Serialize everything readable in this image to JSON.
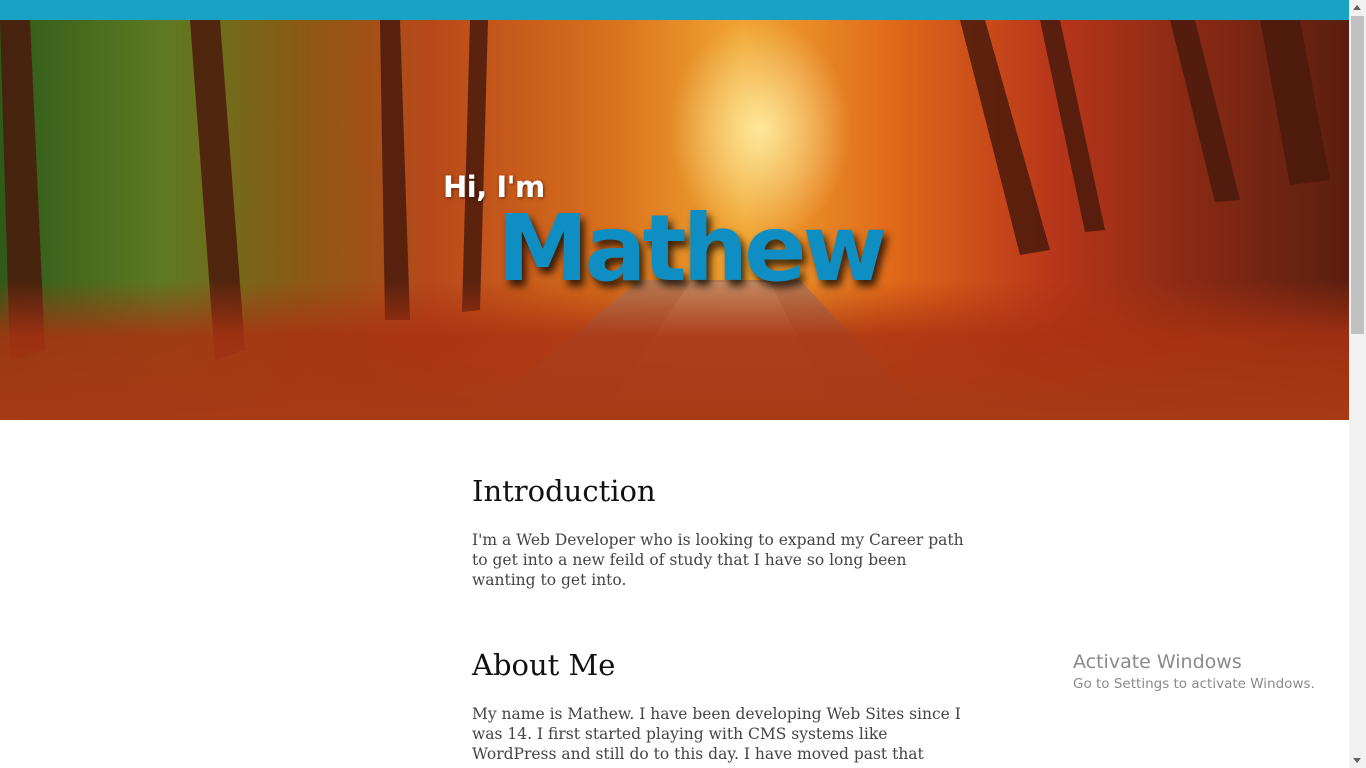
{
  "hero": {
    "greeting": "Hi, I'm",
    "name": "Mathew"
  },
  "sections": [
    {
      "heading": "Introduction",
      "text": "I'm a Web Developer who is looking to expand my Career path to get into a new feild of study that I have so long been wanting to get into."
    },
    {
      "heading": "About Me",
      "text": "My name is Mathew. I have been developing Web Sites since I was 14. I first started playing with CMS systems like WordPress and still do to this day. I have moved past that"
    }
  ],
  "watermark": {
    "title": "Activate Windows",
    "subtitle": "Go to Settings to activate Windows."
  },
  "colors": {
    "topbar": "#17a2c6",
    "name_accent": "#0f8ec4"
  }
}
